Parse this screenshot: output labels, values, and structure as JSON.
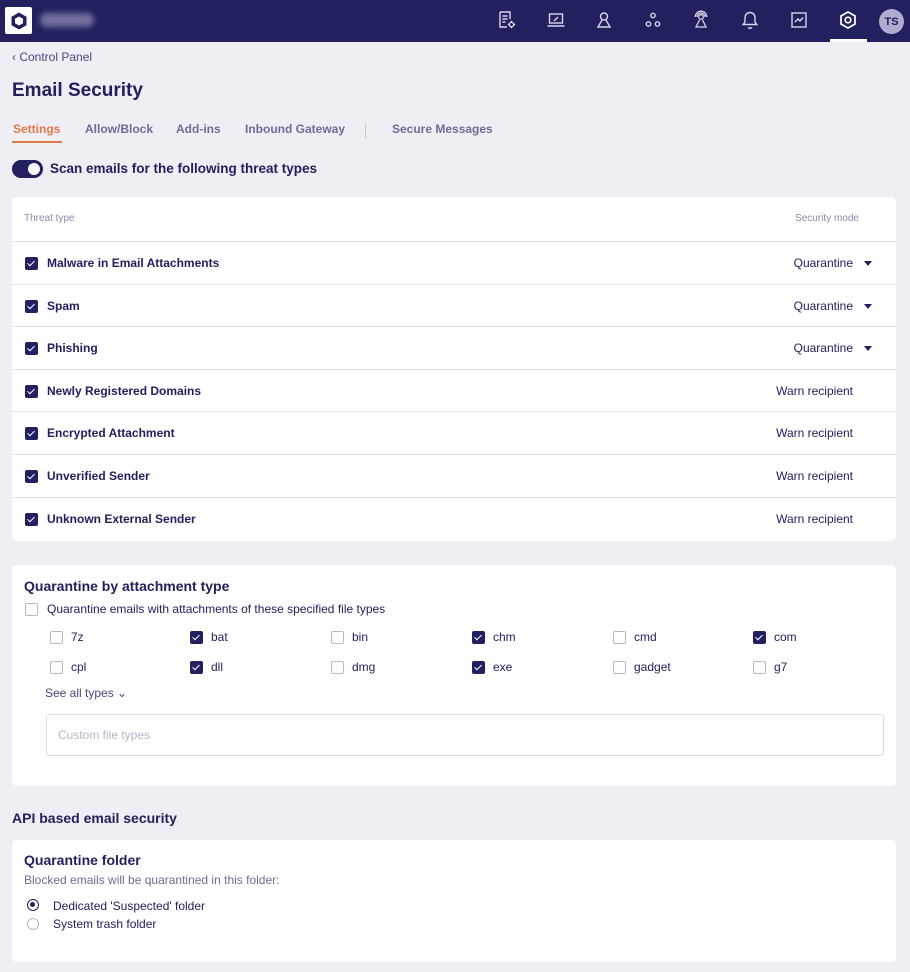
{
  "topbar": {
    "brand_blurred": true,
    "nav_icons": [
      {
        "name": "policy-settings-icon",
        "label": "Policy"
      },
      {
        "name": "laptop-icon",
        "label": "Devices"
      },
      {
        "name": "user-icon",
        "label": "Users"
      },
      {
        "name": "network-nodes-icon",
        "label": "Network"
      },
      {
        "name": "user-signal-icon",
        "label": "Access"
      },
      {
        "name": "bell-icon",
        "label": "Notifications"
      },
      {
        "name": "chart-icon",
        "label": "Reports"
      },
      {
        "name": "settings-hex-icon",
        "label": "Settings",
        "active": true
      }
    ],
    "avatar_initials": "TS"
  },
  "breadcrumb": {
    "label": "‹ Control Panel"
  },
  "page_title": "Email Security",
  "tabs": [
    {
      "label": "Settings",
      "active": true
    },
    {
      "label": "Allow/Block",
      "active": false
    },
    {
      "label": "Add-ins",
      "active": false
    },
    {
      "label": "Inbound Gateway",
      "active": false
    },
    {
      "label": "Secure Messages",
      "active": false
    }
  ],
  "scan_toggle": {
    "label": "Scan emails for the following threat types",
    "on": true
  },
  "threat_table": {
    "headers": {
      "threat_type": "Threat type",
      "security_mode": "Security mode"
    },
    "rows": [
      {
        "label": "Malware in Email Attachments",
        "checked": true,
        "mode": "Quarantine",
        "dropdown": true
      },
      {
        "label": "Spam",
        "checked": true,
        "mode": "Quarantine",
        "dropdown": true
      },
      {
        "label": "Phishing",
        "checked": true,
        "mode": "Quarantine",
        "dropdown": true
      },
      {
        "label": "Newly Registered Domains",
        "checked": true,
        "mode": "Warn recipient",
        "dropdown": false
      },
      {
        "label": "Encrypted Attachment",
        "checked": true,
        "mode": "Warn recipient",
        "dropdown": false
      },
      {
        "label": "Unverified Sender",
        "checked": true,
        "mode": "Warn recipient",
        "dropdown": false
      },
      {
        "label": "Unknown External Sender",
        "checked": true,
        "mode": "Warn recipient",
        "dropdown": false
      }
    ]
  },
  "attachment_quarantine": {
    "title": "Quarantine by attachment type",
    "option_label": "Quarantine emails with attachments of these specified file types",
    "option_checked": false,
    "file_types": [
      {
        "label": "7z",
        "checked": false
      },
      {
        "label": "bat",
        "checked": true
      },
      {
        "label": "bin",
        "checked": false
      },
      {
        "label": "chm",
        "checked": true
      },
      {
        "label": "cmd",
        "checked": false
      },
      {
        "label": "com",
        "checked": true
      },
      {
        "label": "cpl",
        "checked": false
      },
      {
        "label": "dll",
        "checked": true
      },
      {
        "label": "dmg",
        "checked": false
      },
      {
        "label": "exe",
        "checked": true
      },
      {
        "label": "gadget",
        "checked": false
      },
      {
        "label": "g7",
        "checked": false
      }
    ],
    "see_all_label": "See all types ⌄",
    "custom_input": {
      "placeholder": "Custom file types",
      "value": ""
    }
  },
  "api_section": {
    "title": "API based email security",
    "quarantine_folder": {
      "title": "Quarantine folder",
      "subtitle": "Blocked emails will be quarantined in this folder:",
      "options": [
        {
          "label": "Dedicated 'Suspected' folder",
          "selected": true
        },
        {
          "label": "System trash folder",
          "selected": false
        }
      ]
    }
  },
  "colors": {
    "topbar": "#22205e",
    "accent_tab": "#e07a4a",
    "primary": "#22205e",
    "background": "#efeef4"
  }
}
